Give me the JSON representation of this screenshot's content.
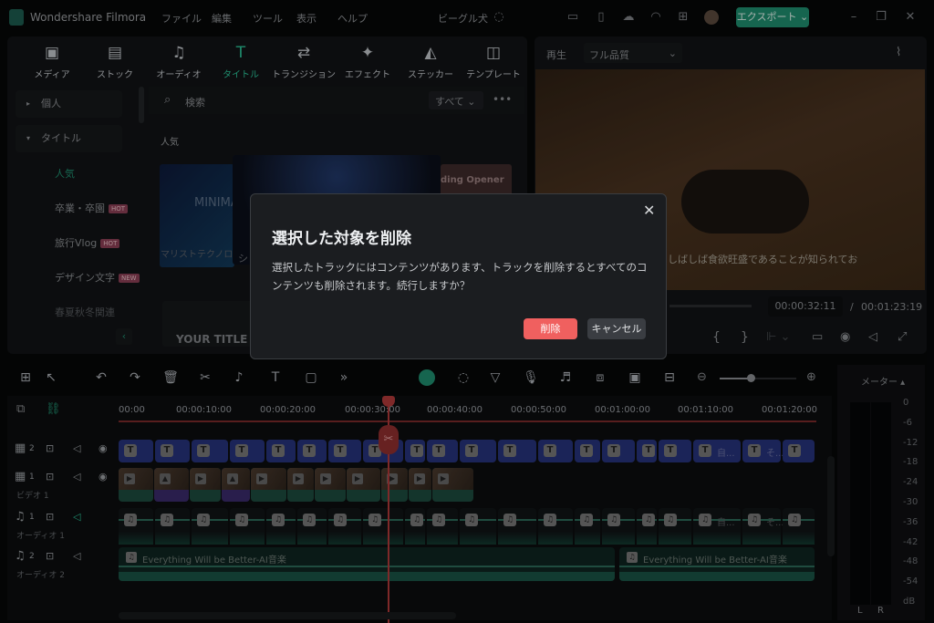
{
  "app": {
    "name": "Wondershare Filmora",
    "project": "ビーグル犬",
    "export_label": "エクスポート ⌄"
  },
  "menu": [
    "ファイル",
    "編集",
    "ツール",
    "表示",
    "ヘルプ"
  ],
  "header_icons": [
    "layout-icon",
    "save-icon",
    "cloud-upload-icon",
    "headset-icon",
    "grid-icon",
    "avatar"
  ],
  "media_tabs": [
    {
      "label": "メディア",
      "icon": "▣"
    },
    {
      "label": "ストック",
      "icon": "▤"
    },
    {
      "label": "オーディオ",
      "icon": "♫"
    },
    {
      "label": "タイトル",
      "icon": "T",
      "active": true
    },
    {
      "label": "トランジション",
      "icon": "⇄"
    },
    {
      "label": "エフェクト",
      "icon": "✦"
    },
    {
      "label": "ステッカー",
      "icon": "◭"
    },
    {
      "label": "テンプレート",
      "icon": "◫"
    }
  ],
  "sidebar": {
    "groups": [
      {
        "label": "個人"
      },
      {
        "label": "タイトル"
      }
    ],
    "items": [
      {
        "label": "人気",
        "active": true
      },
      {
        "label": "卒業・卒園",
        "badge": "HOT"
      },
      {
        "label": "旅行Vlog",
        "badge": "HOT"
      },
      {
        "label": "デザイン文字",
        "badge": "NEW"
      },
      {
        "label": "春夏秋冬関連"
      }
    ]
  },
  "search": {
    "placeholder": "検索",
    "filter": "すべて"
  },
  "section_label": "人気",
  "thumbs": [
    {
      "title": "MINIMAL TECHNO",
      "caption": "マリストテクノロジー"
    },
    {
      "caption": "シ"
    },
    {
      "title": "ding Opener"
    },
    {
      "title": "YOUR TITLE"
    }
  ],
  "preview": {
    "label": "再生",
    "quality": "フル品質",
    "subtitle": "しばしば食欲旺盛であることが知られてお",
    "current_time": "00:00:32:11",
    "separator": "/",
    "total_time": "00:01:23:19"
  },
  "timeline": {
    "ruler": [
      "00:00",
      "00:00:10:00",
      "00:00:20:00",
      "00:00:30:00",
      "00:00:40:00",
      "00:00:50:00",
      "00:01:00:00",
      "00:01:10:00",
      "00:01:20:00"
    ],
    "tracks": [
      {
        "num": "2",
        "name": ""
      },
      {
        "num": "1",
        "name": "ビデオ 1"
      },
      {
        "num": "1",
        "name": "オーディオ 1"
      },
      {
        "num": "2",
        "name": "オーディオ 2"
      }
    ],
    "title_clip_labels": [
      "自...",
      "そ..."
    ],
    "audio_clip": "Everything Will be Better-AI音楽"
  },
  "meter": {
    "label": "メーター ▴",
    "scale": [
      "0",
      "-6",
      "-12",
      "-18",
      "-24",
      "-30",
      "-36",
      "-42",
      "-48",
      "-54",
      "dB"
    ],
    "channels": [
      "L",
      "R"
    ]
  },
  "dialog": {
    "title": "選択した対象を削除",
    "message": "選択したトラックにはコンテンツがあります、トラックを削除するとすべてのコンテンツも削除されます。続行しますか？",
    "confirm": "削除",
    "cancel": "キャンセル",
    "close": "✕"
  },
  "colors": {
    "accent": "#1f8d6e",
    "danger": "#f0605f",
    "title_clip": "#2c3a8a",
    "playhead": "#b03a3a"
  }
}
